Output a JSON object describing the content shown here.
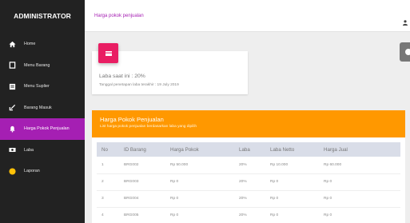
{
  "brand": "ADMINISTRATOR",
  "breadcrumb": "Harga pokok penjualan",
  "sidebar": {
    "items": [
      {
        "label": "Home"
      },
      {
        "label": "Menu Barang"
      },
      {
        "label": "Menu Suplier"
      },
      {
        "label": "Barang Masuk"
      },
      {
        "label": "Harga Pokok Penjualan"
      },
      {
        "label": "Laba"
      },
      {
        "label": "Laporan"
      }
    ]
  },
  "summary": {
    "title": "Laba saat ini : 20%",
    "subtitle": "Tanggal penetapan laba terakhir : 19 July 2019"
  },
  "panel": {
    "title": "Harga Pokok Penjualan",
    "description": "List harga pokok penjualan berdasarkan laba yang dipilih"
  },
  "table": {
    "headers": [
      "No",
      "ID Barang",
      "Harga Pokok",
      "Laba",
      "Laba Netto",
      "Harga Jual"
    ],
    "rows": [
      [
        "1",
        "BRG002",
        "Rp 50.000",
        "20%",
        "Rp 10.000",
        "Rp 60.000"
      ],
      [
        "2",
        "BRG003",
        "Rp 0",
        "20%",
        "Rp 0",
        "Rp 0"
      ],
      [
        "3",
        "BRG004",
        "Rp 0",
        "20%",
        "Rp 0",
        "Rp 0"
      ],
      [
        "4",
        "BRG005",
        "Rp 0",
        "20%",
        "Rp 0",
        "Rp 0"
      ]
    ]
  },
  "colors": {
    "sidebar_bg": "#222222",
    "active_item": "#a51fb3",
    "panel_header": "#ff9800",
    "card_icon": "#e91e63",
    "laporan_icon": "#ffc107"
  }
}
